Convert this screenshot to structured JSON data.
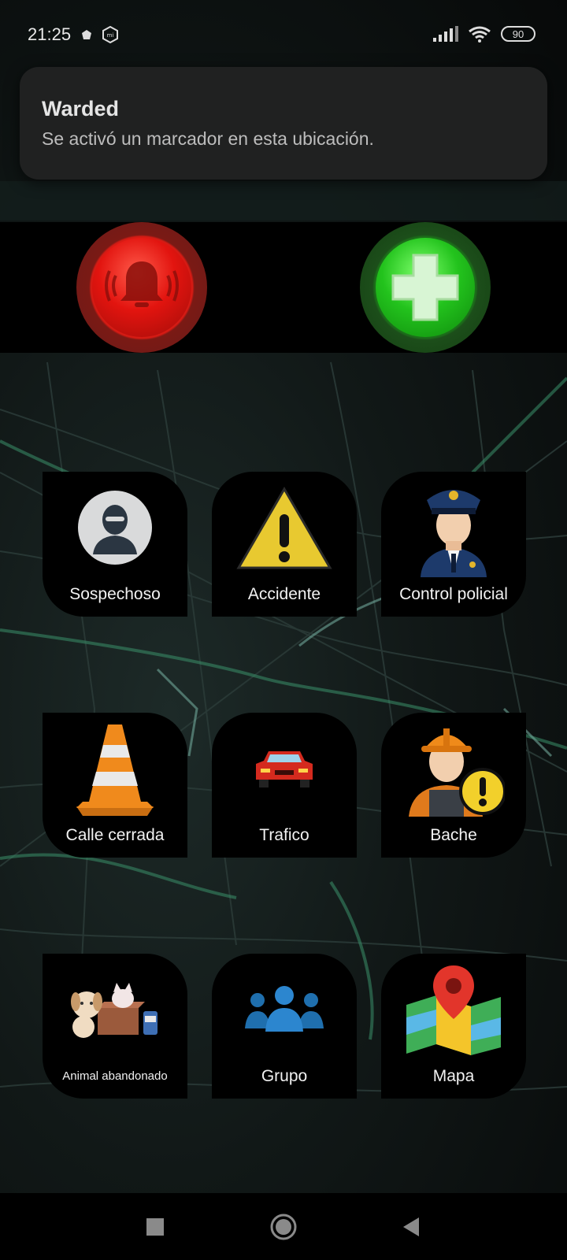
{
  "status_bar": {
    "time": "21:25",
    "battery": "90",
    "icons": [
      "notification-dot-icon",
      "mi-app-icon",
      "signal-icon",
      "wifi-icon",
      "battery-icon"
    ]
  },
  "notification": {
    "title": "Warded",
    "body": "Se activó un marcador en esta ubicación."
  },
  "emergency": {
    "panic_icon": "alarm-bell-icon",
    "health_icon": "medical-cross-icon",
    "colors": {
      "panic": "#e2140f",
      "health": "#23c31d"
    }
  },
  "tiles": [
    {
      "label": "Sospechoso",
      "icon": "masked-person-icon"
    },
    {
      "label": "Accidente",
      "icon": "warning-triangle-icon"
    },
    {
      "label": "Control policial",
      "icon": "police-officer-icon"
    },
    {
      "label": "Calle cerrada",
      "icon": "traffic-cone-icon"
    },
    {
      "label": "Trafico",
      "icon": "car-icon"
    },
    {
      "label": "Bache",
      "icon": "construction-worker-icon"
    },
    {
      "label": "Animal abandonado",
      "icon": "abandoned-animals-icon"
    },
    {
      "label": "Grupo",
      "icon": "group-icon"
    },
    {
      "label": "Mapa",
      "icon": "map-pin-icon"
    }
  ],
  "nav_bar": {
    "buttons": [
      "recents-square-icon",
      "home-circle-icon",
      "back-triangle-icon"
    ]
  }
}
